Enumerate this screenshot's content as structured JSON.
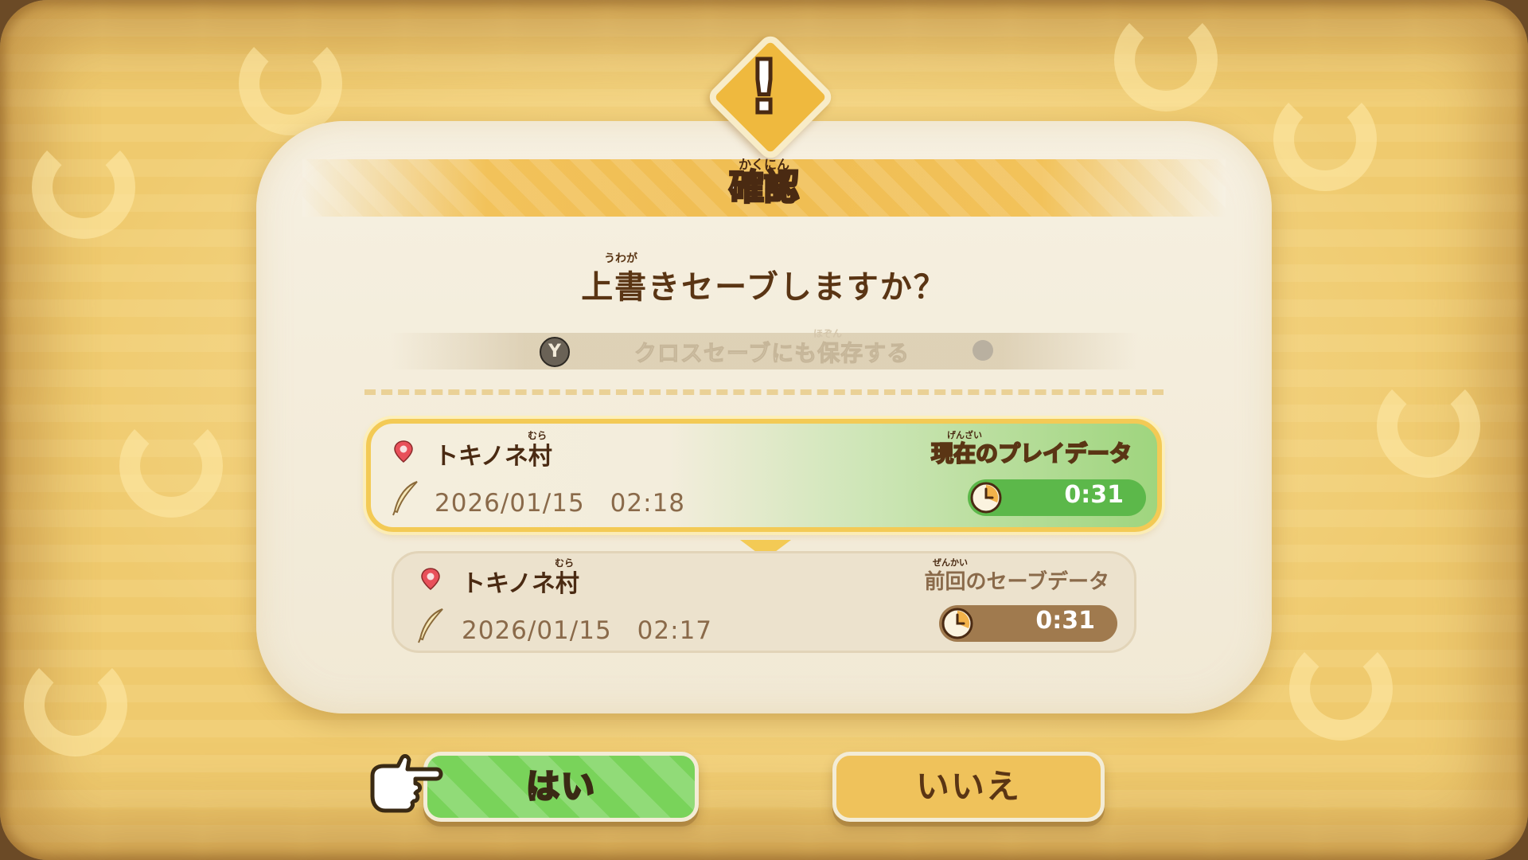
{
  "dialog": {
    "title": "確認",
    "title_ruby": "かくにん",
    "question": "上書きセーブしますか？",
    "question_ruby": "うわが",
    "cross_save": {
      "button": "Y",
      "label": "クロスセーブにも保存する",
      "label_ruby": "ほぞん",
      "enabled": false
    },
    "current": {
      "tag": "現在のプレイデータ",
      "tag_ruby": "げんざい",
      "place": "トキノネ村",
      "place_ruby": "むら",
      "datetime": "2026/01/15　02:18",
      "playtime": "0:31"
    },
    "previous": {
      "tag": "前回のセーブデータ",
      "tag_ruby": "ぜんかい",
      "place": "トキノネ村",
      "place_ruby": "むら",
      "datetime": "2026/01/15　02:17",
      "playtime": "0:31"
    },
    "buttons": {
      "yes": "はい",
      "no": "いいえ",
      "selected": "yes"
    }
  },
  "icons": {
    "warning": "exclamation-icon",
    "location": "map-pin-icon",
    "save_time": "quill-pen-icon",
    "playtime": "clock-icon",
    "cursor": "pointing-hand-icon"
  },
  "colors": {
    "accent_orange": "#efb93e",
    "current_green": "#79d35a",
    "previous_brown": "#a07a4e",
    "text_brown": "#5a3514"
  }
}
